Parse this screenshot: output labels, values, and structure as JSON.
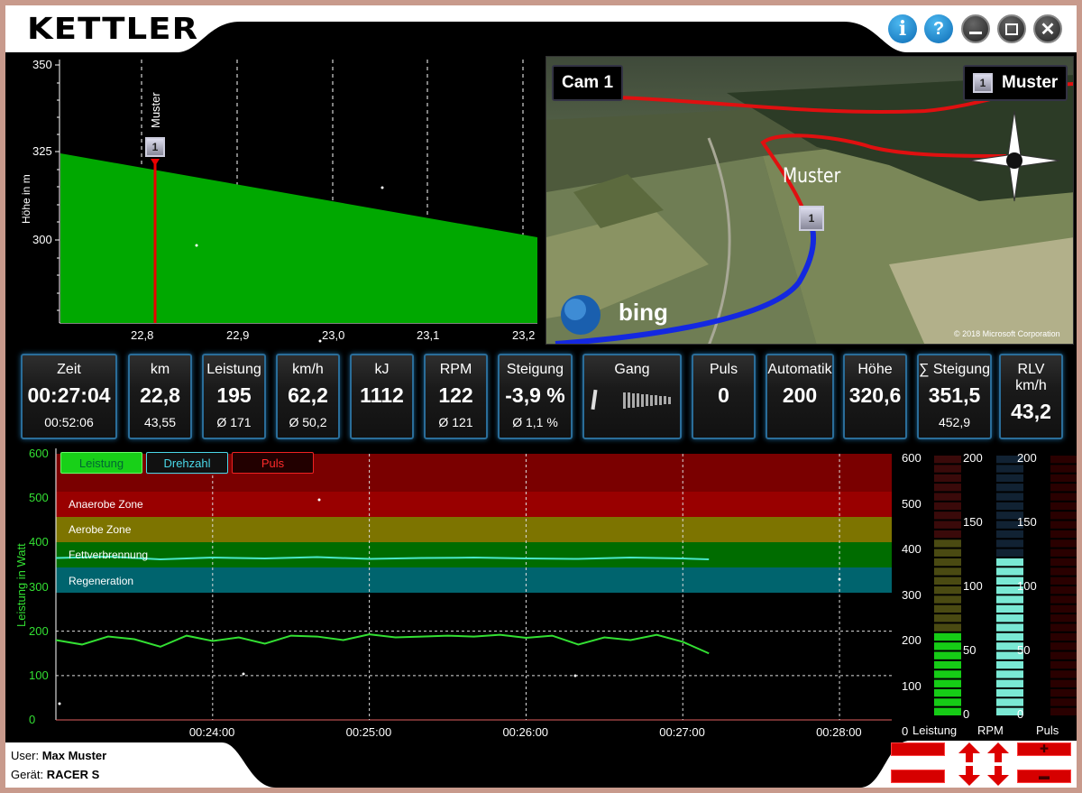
{
  "header": {
    "logo": "KETTLER"
  },
  "window_buttons": [
    "info-icon",
    "help-icon",
    "minimize-icon",
    "maximize-icon",
    "close-icon"
  ],
  "elevation": {
    "ylabel": "Höhe in m",
    "yticks": [
      "350",
      "325",
      "300"
    ],
    "xticks": [
      "22,8",
      "22,9",
      "23,0",
      "23,1",
      "23,2"
    ],
    "rider_name": "Muster",
    "rider_number": "1",
    "fill_color": "#00a800"
  },
  "map": {
    "cam_label": "Cam 1",
    "rider_number": "1",
    "rider_name": "Muster",
    "marker_label": "Muster",
    "marker_number": "1",
    "bing": "bing",
    "copyright": "© 2018 Microsoft Corporation"
  },
  "stats": [
    {
      "label": "Zeit",
      "value": "00:27:04",
      "sub": "00:52:06"
    },
    {
      "label": "km",
      "value": "22,8",
      "sub": "43,55"
    },
    {
      "label": "Leistung",
      "value": "195",
      "sub": "Ø 171"
    },
    {
      "label": "km/h",
      "value": "62,2",
      "sub": "Ø 50,2"
    },
    {
      "label": "kJ",
      "value": "1112",
      "sub": ""
    },
    {
      "label": "RPM",
      "value": "122",
      "sub": "Ø 121"
    },
    {
      "label": "Steigung",
      "value": "-3,9 %",
      "sub": "Ø 1,1 %"
    },
    {
      "label": "Gang",
      "value": "",
      "sub": ""
    },
    {
      "label": "Puls",
      "value": "0",
      "sub": ""
    },
    {
      "label": "Automatik",
      "value": "200",
      "sub": ""
    },
    {
      "label": "Höhe",
      "value": "320,6",
      "sub": ""
    },
    {
      "label": "∑ Steigung",
      "value": "351,5",
      "sub": "452,9"
    },
    {
      "label": "RLV km/h",
      "value": "43,2",
      "sub": ""
    }
  ],
  "chart": {
    "ylabel": "Leistung in Watt",
    "yticks": [
      "600",
      "500",
      "400",
      "300",
      "200",
      "100",
      "0"
    ],
    "xticks": [
      "00:24:00",
      "00:25:00",
      "00:26:00",
      "00:27:00",
      "00:28:00"
    ],
    "legend": {
      "leistung": "Leistung",
      "drehzahl": "Drehzahl",
      "puls": "Puls"
    },
    "zones": {
      "anaerob": "Anaerobe Zone",
      "aerob": "Aerobe Zone",
      "fett": "Fettverbrennung",
      "regen": "Regeneration"
    }
  },
  "chart_data": {
    "type": "line",
    "ylabel": "Leistung in Watt",
    "ylim": [
      0,
      600
    ],
    "xlim_seconds": [
      1380,
      1700
    ],
    "series": [
      {
        "name": "Leistung",
        "color": "#33e033",
        "x": [
          1380,
          1390,
          1400,
          1410,
          1420,
          1430,
          1440,
          1450,
          1460,
          1470,
          1480,
          1490,
          1500,
          1510,
          1520,
          1530,
          1540,
          1550,
          1560,
          1570,
          1580,
          1590,
          1600,
          1610,
          1620,
          1630
        ],
        "y": [
          180,
          170,
          188,
          182,
          165,
          190,
          178,
          186,
          172,
          190,
          188,
          180,
          193,
          186,
          188,
          190,
          188,
          192,
          185,
          190,
          170,
          186,
          180,
          192,
          176,
          150
        ]
      },
      {
        "name": "Drehzahl",
        "color": "#4ae8c8",
        "x": [
          1380,
          1400,
          1420,
          1440,
          1460,
          1480,
          1500,
          1520,
          1540,
          1560,
          1580,
          1600,
          1620,
          1630
        ],
        "y": [
          365,
          368,
          362,
          366,
          364,
          367,
          363,
          365,
          366,
          364,
          363,
          366,
          364,
          362
        ]
      }
    ]
  },
  "bars": {
    "left_ticks": [
      "600",
      "500",
      "400",
      "300",
      "200",
      "100",
      "0"
    ],
    "mid_ticks": [
      "200",
      "150",
      "100",
      "50",
      "0"
    ],
    "right_ticks": [
      "200",
      "150",
      "100",
      "50",
      "0"
    ],
    "labels": {
      "leistung": "Leistung",
      "rpm": "RPM",
      "puls": "Puls"
    },
    "leistung_value": 195,
    "rpm_value": 122,
    "puls_value": 0
  },
  "footer": {
    "user_label": "User:",
    "user_name": "Max Muster",
    "device_label": "Gerät:",
    "device_name": "RACER S"
  }
}
